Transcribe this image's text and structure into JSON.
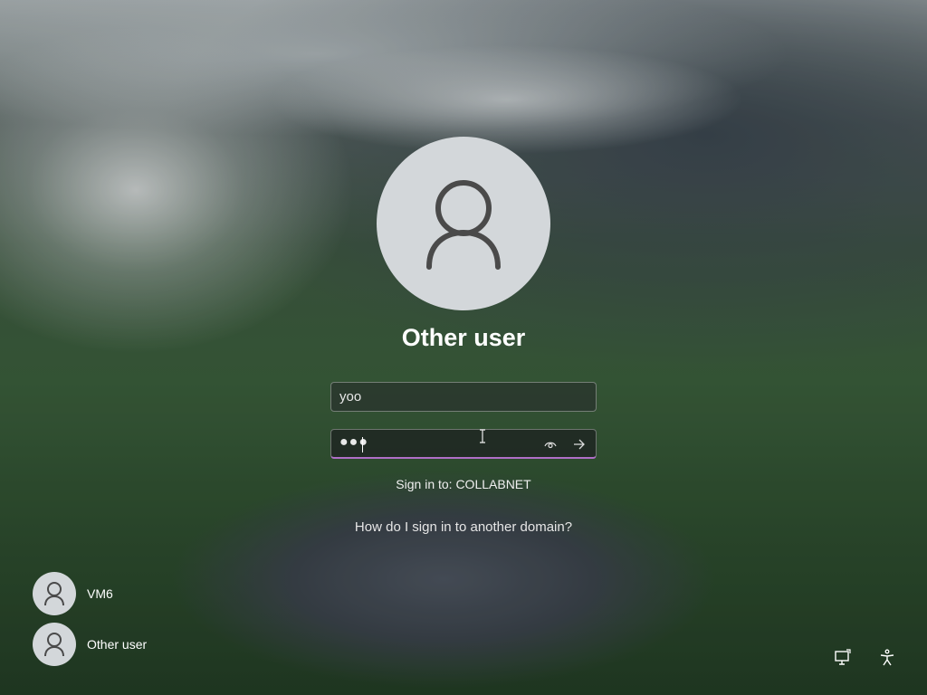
{
  "login": {
    "title": "Other user",
    "username_value": "yoo",
    "password_mask": "●●●",
    "sign_in_to": "Sign in to: COLLABNET",
    "domain_help_link": "How do I sign in to another domain?"
  },
  "user_list": [
    {
      "name": "VM6"
    },
    {
      "name": "Other user"
    }
  ],
  "icons": {
    "avatar": "person-icon",
    "reveal_password": "eye-icon",
    "submit": "arrow-right-icon",
    "network": "network-icon",
    "accessibility": "accessibility-icon"
  },
  "colors": {
    "focus_underline": "#b06ec7",
    "avatar_bg": "#d3d7da"
  }
}
